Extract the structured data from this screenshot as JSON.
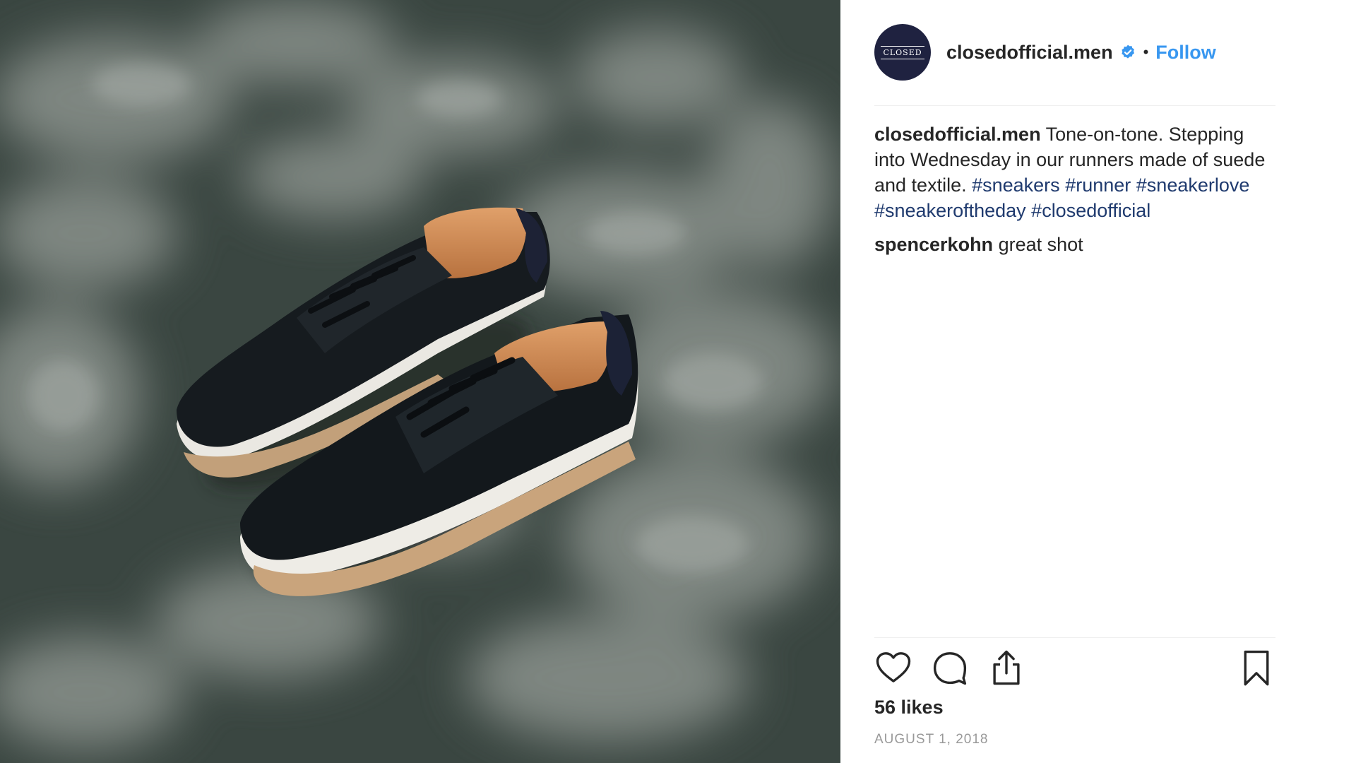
{
  "post": {
    "image_alt": "Pair of dark navy suede and textile runner sneakers on a shaded grey surface",
    "account": {
      "username": "closedofficial.men",
      "avatar_text": "CLOSED",
      "verified": true,
      "separator": "•",
      "follow_label": "Follow"
    },
    "caption": {
      "username": "closedofficial.men",
      "text": " Tone-on-tone. Stepping into Wednesday in our runners made of suede and textile. ",
      "hashtags": [
        "#sneakers",
        "#runner",
        "#sneakerlove",
        "#sneakeroftheday",
        "#closedofficial"
      ]
    },
    "comments": [
      {
        "username": "spencerkohn",
        "text": " great shot"
      }
    ],
    "actions": {
      "like_icon": "heart-icon",
      "comment_icon": "comment-icon",
      "share_icon": "share-icon",
      "save_icon": "bookmark-icon"
    },
    "likes_text": "56 likes",
    "date": "AUGUST 1, 2018"
  },
  "colors": {
    "link_blue": "#3897f0",
    "hashtag": "#1f3a6e",
    "avatar_bg": "#1f2240",
    "text": "#262626",
    "muted": "#999999"
  }
}
